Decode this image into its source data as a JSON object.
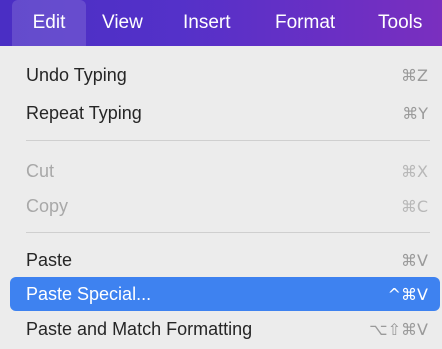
{
  "menubar": {
    "items": [
      {
        "label": "Edit",
        "active": true
      },
      {
        "label": "View"
      },
      {
        "label": "Insert"
      },
      {
        "label": "Format"
      },
      {
        "label": "Tools"
      }
    ],
    "gradient_colors": [
      "#4a2ec4",
      "#7a2fbf"
    ]
  },
  "edit_menu": {
    "items": [
      {
        "label": "Undo Typing",
        "shortcut": "⌘Z",
        "enabled": true
      },
      {
        "label": "Repeat Typing",
        "shortcut": "⌘Y",
        "enabled": true
      },
      {
        "label": "Cut",
        "shortcut": "⌘X",
        "enabled": false
      },
      {
        "label": "Copy",
        "shortcut": "⌘C",
        "enabled": false
      },
      {
        "label": "Paste",
        "shortcut": "⌘V",
        "enabled": true
      },
      {
        "label": "Paste Special...",
        "shortcut": "^⌘V",
        "enabled": true,
        "highlighted": true
      },
      {
        "label": "Paste and Match Formatting",
        "shortcut": "⌥⇧⌘V",
        "enabled": true
      }
    ],
    "highlight_color": "#3e82f0",
    "background_color": "#ececec"
  }
}
